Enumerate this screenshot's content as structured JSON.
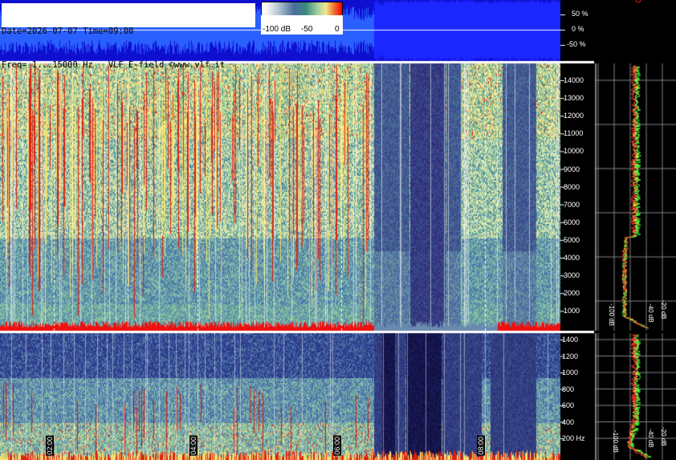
{
  "header": {
    "line1": "Date=2026-07-07 Time=09:00",
    "line2": "Freq= 1...15000 Hz   VLF E-field ©www.vlf.it"
  },
  "colorbar": {
    "labels": [
      "-100 dB",
      "-50",
      "0"
    ]
  },
  "waveform_axis": {
    "labels": [
      "50 %",
      "0 %",
      "-50 %"
    ]
  },
  "spectrum_upper_axis": {
    "labels": [
      "14000",
      "13000",
      "12000",
      "11000",
      "10000",
      "9000",
      "8000",
      "7000",
      "6000",
      "5000",
      "4000",
      "3000",
      "2000",
      "1000"
    ]
  },
  "spectrum_lower_axis": {
    "labels": [
      "1400",
      "1200",
      "1000",
      "800",
      "600",
      "400",
      "200 Hz"
    ]
  },
  "profile_db_labels_upper": [
    "-100 dB",
    "-40 dB",
    "-20 dB"
  ],
  "profile_db_labels_lower": [
    "-100 dB",
    "-40 dB",
    "-20 dB"
  ],
  "time_labels": [
    "02:00",
    "04:00",
    "06:00",
    "08:00"
  ],
  "colors": {
    "waveform": "#1a1ae6",
    "axis_line": "#ffffff",
    "profile_trace_a": "#ffff40",
    "profile_trace_b": "#40ff40",
    "profile_trace_c": "#ff3030"
  }
}
